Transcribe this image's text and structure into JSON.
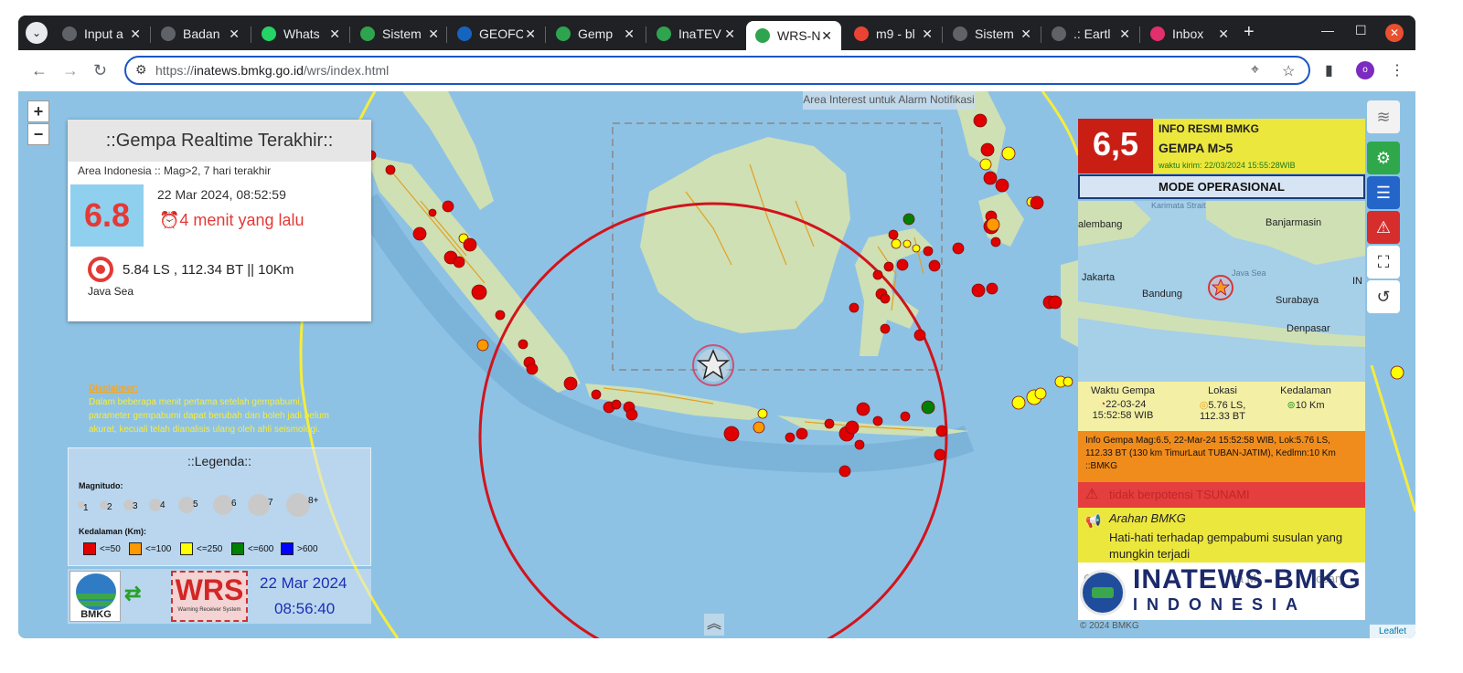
{
  "browser": {
    "tabs": [
      {
        "label": "Input a",
        "color": "#5f6368"
      },
      {
        "label": "Badan",
        "color": "#5f6368"
      },
      {
        "label": "Whats",
        "color": "#25d366"
      },
      {
        "label": "Sistem",
        "color": "#2fa44f"
      },
      {
        "label": "GEOFC",
        "color": "#1565c0"
      },
      {
        "label": "Gemp",
        "color": "#2fa44f"
      },
      {
        "label": "InaTEV",
        "color": "#2fa44f"
      },
      {
        "label": "WRS-N",
        "color": "#2fa44f",
        "active": true
      },
      {
        "label": "m9 - bl",
        "color": "#ea4335"
      },
      {
        "label": "Sistem",
        "color": "#5f6368"
      },
      {
        "label": ".: Eartl",
        "color": "#5f6368"
      },
      {
        "label": "Inbox",
        "color": "#e1306c"
      }
    ],
    "url_prefix": "https://",
    "url_domain": "inatews.bmkg.go.id",
    "url_path": "/wrs/index.html",
    "profile_initial": "o"
  },
  "map": {
    "area_interest": "Area Interest untuk Alarm Notifikasi",
    "zoom_in": "+",
    "zoom_out": "−",
    "copyright": "© 2024 BMKG",
    "leaflet": "Leaflet"
  },
  "realtime": {
    "title": "::Gempa Realtime Terakhir::",
    "area": "Area Indonesia :: Mag>2, 7 hari terakhir",
    "magnitude": "6.8",
    "datetime": "22 Mar 2024, 08:52:59",
    "ago": "⏰4 menit yang lalu",
    "location": "5.84 LS , 112.34 BT || 10Km",
    "region": "Java Sea"
  },
  "disclaimer": {
    "title": "Disclaimer:",
    "text": "Dalam beberapa menit pertama setelah gempabumi, parameter gempabumi dapat berubah dan boleh jadi belum akurat, kecuali telah dianalisis ulang oleh ahli seismologi."
  },
  "legend": {
    "title": "::Legenda::",
    "magnitude_label": "Magnitudo:",
    "depth_label": "Kedalaman (Km):",
    "magnitudes": [
      "1",
      "2",
      "3",
      "4",
      "5",
      "6",
      "7",
      "8+"
    ],
    "depths": [
      {
        "label": "<=50",
        "color": "#e00000"
      },
      {
        "label": "<=100",
        "color": "#ff9900"
      },
      {
        "label": "<=250",
        "color": "#ffff00"
      },
      {
        "label": "<=600",
        "color": "#008000"
      },
      {
        "label": ">600",
        "color": "#0000ff"
      }
    ]
  },
  "clock": {
    "bmkg_label": "BMKG",
    "wrs_label": "WRS",
    "wrs_sub": "Warning Receiver System",
    "date": "22 Mar 2024",
    "time": "08:56:40"
  },
  "info": {
    "magnitude": "6,5",
    "heading": "INFO RESMI BMKG",
    "subheading": "GEMPA M>5",
    "sent": "waktu kirim: 22/03/2024 15:55:28WIB",
    "mode": "MODE OPERASIONAL",
    "minimap_labels": [
      "Karimata Strait",
      "alembang",
      "Banjarmasin",
      "Jakarta",
      "Bandung",
      "Java Sea",
      "Surabaya",
      "Denpasar",
      "IN"
    ],
    "stat_time_label": "Waktu Gempa",
    "stat_time_value": "22-03-24 15:52:58 WIB",
    "stat_loc_label": "Lokasi",
    "stat_loc_value": "5.76 LS, 112.33 BT",
    "stat_depth_label": "Kedalaman",
    "stat_depth_value": "10 Km",
    "description": "Info Gempa Mag:6.5, 22-Mar-24 15:52:58 WIB, Lok:5.76 LS, 112.33 BT (130 km TimurLaut TUBAN-JATIM), Kedlmn:10 Km ::BMKG",
    "tsunami": "tidak berpotensi TSUNAMI",
    "arahan_title": "Arahan BMKG",
    "arahan_text": "Hati-hati terhadap gempabumi susulan yang mungkin terjadi",
    "brand_main": "INATEWS-BMKG",
    "brand_sub": "INDONESIA",
    "faint_left": "Ca",
    "faint_mid": "ta M",
    "faint_right": "osary"
  },
  "colors": {
    "sea": "#8ec2e4",
    "land": "#cfe0b4",
    "quake_shallow": "#e00000"
  }
}
